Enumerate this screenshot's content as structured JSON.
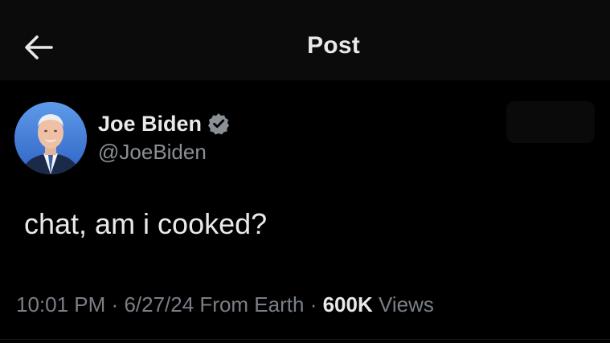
{
  "header": {
    "title": "Post",
    "back_icon": "arrow-left-icon"
  },
  "author": {
    "display_name": "Joe Biden",
    "handle": "@JoeBiden",
    "verified_icon": "verified-badge-icon",
    "verified_color": "#8b9096"
  },
  "post": {
    "text": "chat, am i cooked?"
  },
  "meta": {
    "time": "10:01 PM",
    "separator": "·",
    "date": "6/27/24",
    "location": "From Earth",
    "views_count": "600K",
    "views_label": "Views"
  },
  "colors": {
    "background": "#000000",
    "header_background": "#0b0b0c",
    "primary_text": "#e7e9ea",
    "secondary_text": "#8b9096"
  }
}
